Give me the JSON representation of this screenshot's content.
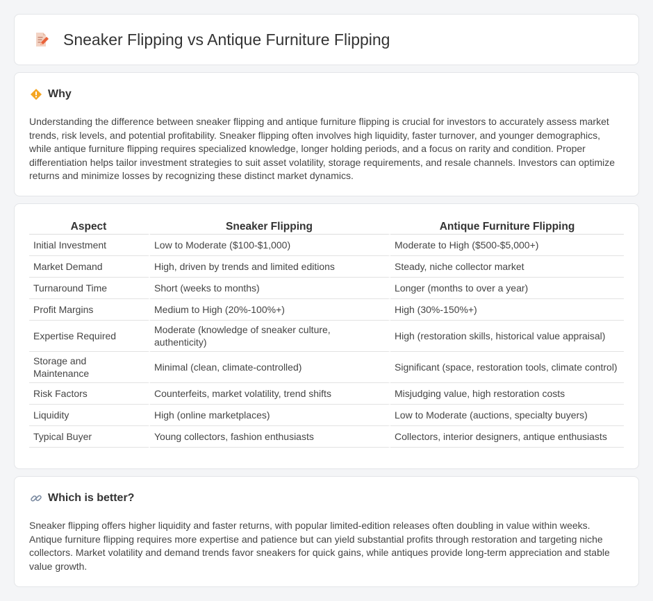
{
  "header": {
    "title": "Sneaker Flipping vs Antique Furniture Flipping",
    "icon": "document-edit-icon"
  },
  "why": {
    "heading": "Why",
    "icon": "diamond-warning-icon",
    "text": "Understanding the difference between sneaker flipping and antique furniture flipping is crucial for investors to accurately assess market trends, risk levels, and potential profitability. Sneaker flipping often involves high liquidity, faster turnover, and younger demographics, while antique furniture flipping requires specialized knowledge, longer holding periods, and a focus on rarity and condition. Proper differentiation helps tailor investment strategies to suit asset volatility, storage requirements, and resale channels. Investors can optimize returns and minimize losses by recognizing these distinct market dynamics."
  },
  "table": {
    "headers": [
      "Aspect",
      "Sneaker Flipping",
      "Antique Furniture Flipping"
    ],
    "rows": [
      [
        "Initial Investment",
        "Low to Moderate ($100-$1,000)",
        "Moderate to High ($500-$5,000+)"
      ],
      [
        "Market Demand",
        "High, driven by trends and limited editions",
        "Steady, niche collector market"
      ],
      [
        "Turnaround Time",
        "Short (weeks to months)",
        "Longer (months to over a year)"
      ],
      [
        "Profit Margins",
        "Medium to High (20%-100%+)",
        "High (30%-150%+)"
      ],
      [
        "Expertise Required",
        "Moderate (knowledge of sneaker culture, authenticity)",
        "High (restoration skills, historical value appraisal)"
      ],
      [
        "Storage and Maintenance",
        "Minimal (clean, climate-controlled)",
        "Significant (space, restoration tools, climate control)"
      ],
      [
        "Risk Factors",
        "Counterfeits, market volatility, trend shifts",
        "Misjudging value, high restoration costs"
      ],
      [
        "Liquidity",
        "High (online marketplaces)",
        "Low to Moderate (auctions, specialty buyers)"
      ],
      [
        "Typical Buyer",
        "Young collectors, fashion enthusiasts",
        "Collectors, interior designers, antique enthusiasts"
      ]
    ]
  },
  "better": {
    "heading": "Which is better?",
    "icon": "link-icon",
    "text": "Sneaker flipping offers higher liquidity and faster returns, with popular limited-edition releases often doubling in value within weeks. Antique furniture flipping requires more expertise and patience but can yield substantial profits through restoration and targeting niche collectors. Market volatility and demand trends favor sneakers for quick gains, while antiques provide long-term appreciation and stable value growth."
  }
}
